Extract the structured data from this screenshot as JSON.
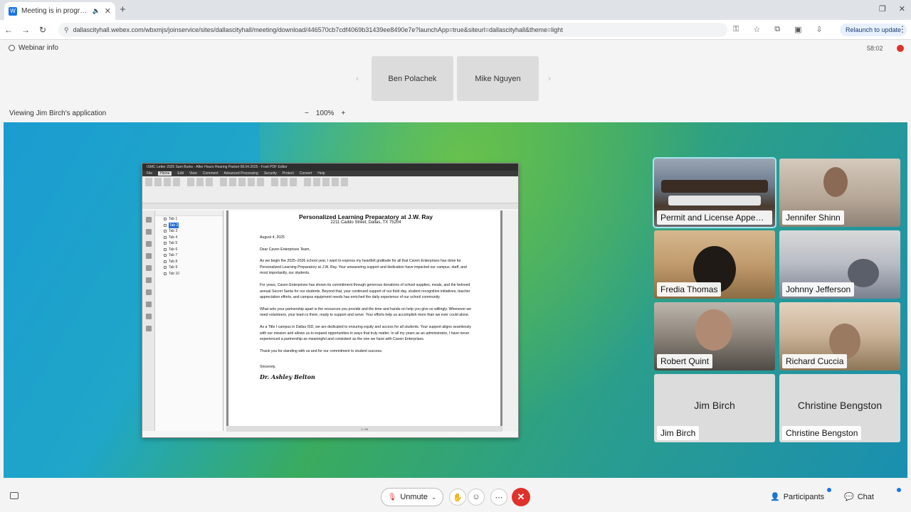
{
  "browser": {
    "tab_title": "Meeting is in progress...",
    "url": "dallascityhall.webex.com/wbxmjs/joinservice/sites/dallascityhall/meeting/download/446570cb7cdf4069b31439ee8490e7e?launchApp=true&siteurl=dallascityhall&theme=light",
    "relaunch_label": "Relaunch to update"
  },
  "webex": {
    "webinar_info": "Webinar info",
    "timer": "58:02",
    "top_tiles": [
      "Ben Polachek",
      "Mike Nguyen"
    ],
    "viewing": "Viewing Jim Birch's application",
    "zoom": "100%",
    "zoom_minus": "−",
    "zoom_plus": "+"
  },
  "shared_app": {
    "window_title": "ISMC Letter 2025 Sam Burks - After Hours Hearing Packet 08.04.2025 - Foxit PDF Editor",
    "menu": [
      "File",
      "Home",
      "Edit",
      "View",
      "Comment",
      "Advanced Processing",
      "Security",
      "Protect",
      "Convert",
      "Help"
    ],
    "active_menu": "Home",
    "bookmarks": [
      "Tab 1",
      "Tab 2",
      "Tab 3",
      "Tab 4",
      "Tab 5",
      "Tab 6",
      "Tab 7",
      "Tab 8",
      "Tab 9",
      "Tab 10"
    ],
    "selected_bookmark": 1,
    "status": "1 / 68"
  },
  "letter": {
    "heading": "Personalized Learning Preparatory at J.W. Ray",
    "address": "2211 Caddo Street, Dallas, TX 75204",
    "date": "August 4, 2025",
    "salutation": "Dear Caven Enterprises Team,",
    "p1": "As we begin the 2025–2026 school year, I want to express my heartfelt gratitude for all that Caven Enterprises has done for Personalized Learning Preparatory at J.W. Ray. Your unwavering support and dedication have impacted our campus, staff, and most importantly, our students.",
    "p2": "For years, Caven Enterprises has shown its commitment through generous donations of school supplies, meals, and the beloved annual Secret Santa for our students. Beyond that, your continued support of our field day, student recognition initiatives, teacher appreciation efforts, and campus equipment needs has enriched the daily experience of our school community.",
    "p3": "What sets your partnership apart is the resources you provide and the time and hands-on help you give so willingly. Whenever we need volunteers, your team is there, ready to support and serve. Your efforts help us accomplish more than we ever could alone.",
    "p4": "As a Title I campus in Dallas ISD, we are dedicated to ensuring equity and access for all students. Your support aligns seamlessly with our mission and allows us to expand opportunities in ways that truly matter. In all my years as an administrator, I have never experienced a partnership as meaningful and consistent as the one we have with Caven Enterprises.",
    "p5": "Thank you for standing with us and for our commitment to student success.",
    "closing": "Sincerely,",
    "signature": "Dr. Ashley Belton"
  },
  "participants": [
    {
      "name": "Permit and License Appeal...",
      "video": "room"
    },
    {
      "name": "Jennifer Shinn",
      "video": "shinn"
    },
    {
      "name": "Fredia Thomas",
      "video": "thomas"
    },
    {
      "name": "Johnny Jefferson",
      "video": "jefferson"
    },
    {
      "name": "Robert Quint",
      "video": "quint"
    },
    {
      "name": "Richard Cuccia",
      "video": "cuccia"
    },
    {
      "name": "Jim Birch",
      "display": "Jim Birch",
      "video": "none"
    },
    {
      "name": "Christine Bengston",
      "display": "Christine Bengston",
      "video": "none"
    }
  ],
  "controls": {
    "unmute": "Unmute",
    "participants": "Participants",
    "chat": "Chat"
  }
}
